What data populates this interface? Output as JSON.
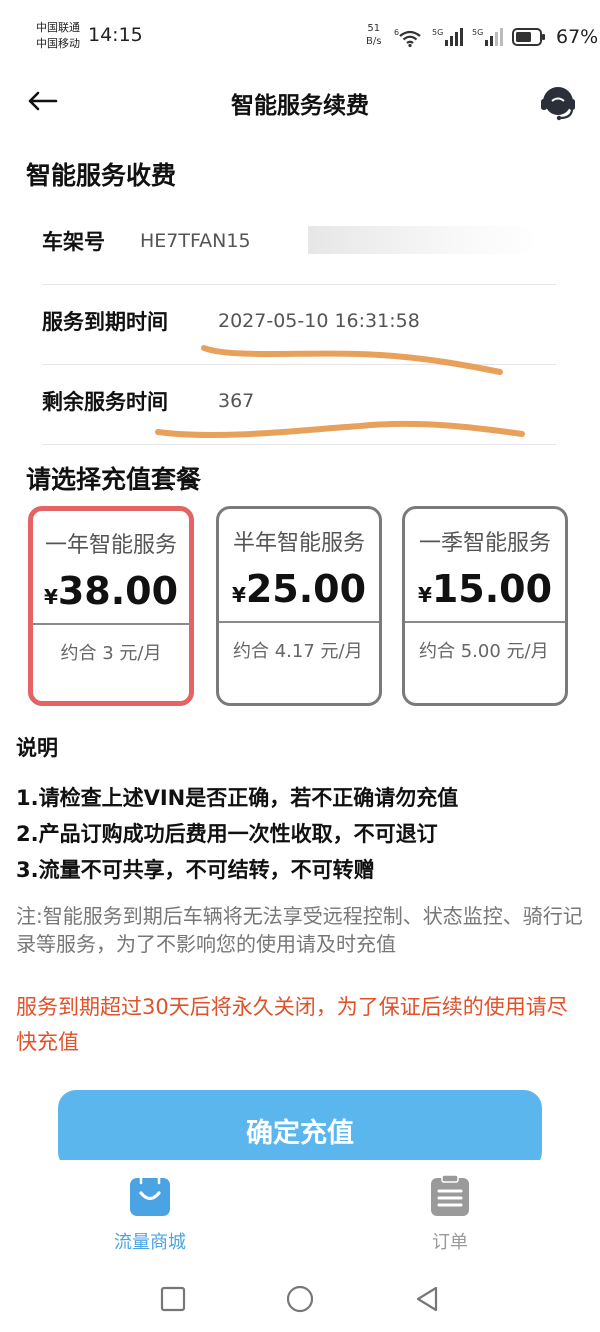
{
  "status_bar": {
    "carrier_1": "中国联通",
    "carrier_2": "中国移动",
    "time": "14:15",
    "speed_value": "51",
    "speed_unit": "B/s",
    "wifi_badge": "6",
    "signal_1_badge": "5G",
    "signal_2_badge": "5G",
    "battery": "67%"
  },
  "header": {
    "title": "智能服务续费",
    "back_icon": "back-arrow-icon",
    "support_icon": "customer-service-icon"
  },
  "service_info": {
    "title": "智能服务收费",
    "rows": [
      {
        "label": "车架号",
        "value": "HE7TFAN15"
      },
      {
        "label": "服务到期时间",
        "value": "2027-05-10 16:31:58"
      },
      {
        "label": "剩余服务时间",
        "value": "367"
      }
    ]
  },
  "plans": {
    "title": "请选择充值套餐",
    "currency": "¥",
    "selected_index": 0,
    "items": [
      {
        "name": "一年智能服务",
        "price": "38.00",
        "monthly": "约合 3 元/月"
      },
      {
        "name": "半年智能服务",
        "price": "25.00",
        "monthly": "约合 4.17 元/月"
      },
      {
        "name": "一季智能服务",
        "price": "15.00",
        "monthly": "约合 5.00 元/月"
      }
    ]
  },
  "description": {
    "title": "说明",
    "rules": [
      "1.请检查上述VIN是否正确，若不正确请勿充值",
      "2.产品订购成功后费用一次性收取，不可退订",
      "3.流量不可共享，不可结转，不可转赠"
    ],
    "note": "注:智能服务到期后车辆将无法享受远程控制、状态监控、骑行记录等服务，为了不影响您的使用请及时充值",
    "warning": "服务到期超过30天后将永久关闭，为了保证后续的使用请尽快充值"
  },
  "confirm_button": "确定充值",
  "tab_bar": {
    "tabs": [
      {
        "label": "流量商城",
        "icon": "shopping-bag-icon",
        "active": true
      },
      {
        "label": "订单",
        "icon": "order-list-icon",
        "active": false
      }
    ]
  },
  "colors": {
    "accent_blue": "#5bb6ee",
    "selected_border": "#e46364",
    "warning_text": "#e2512a",
    "annotation_orange": "#e8a15a",
    "tab_active": "#4aa3e3",
    "tab_inactive": "#9a9a9a"
  }
}
